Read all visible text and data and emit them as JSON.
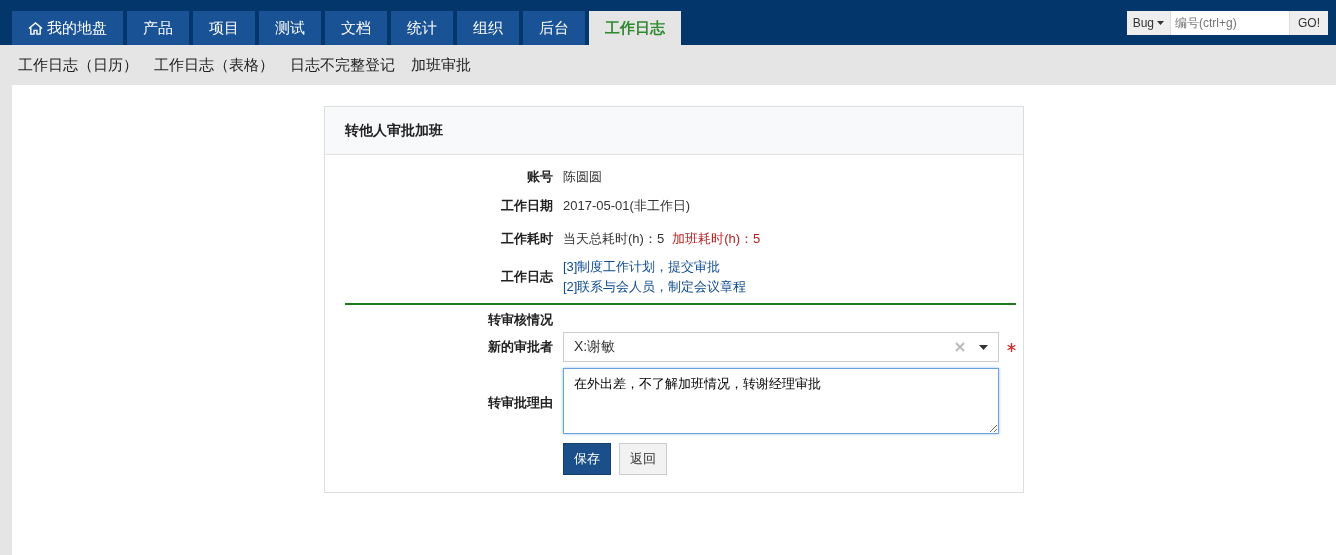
{
  "nav": {
    "tabs": [
      {
        "label": "我的地盘",
        "kind": "home",
        "selected": false
      },
      {
        "label": "产品",
        "selected": false
      },
      {
        "label": "项目",
        "selected": false
      },
      {
        "label": "测试",
        "selected": false
      },
      {
        "label": "文档",
        "selected": false
      },
      {
        "label": "统计",
        "selected": false
      },
      {
        "label": "组织",
        "selected": false
      },
      {
        "label": "后台",
        "selected": false
      },
      {
        "label": "工作日志",
        "selected": true
      }
    ],
    "search": {
      "type": "Bug",
      "placeholder": "编号(ctrl+g)",
      "button": "GO!"
    }
  },
  "subnav": [
    "工作日志（日历）",
    "工作日志（表格）",
    "日志不完整登记",
    "加班审批"
  ],
  "form": {
    "title": "转他人审批加班",
    "account": {
      "label": "账号",
      "value": "陈圆圆"
    },
    "date": {
      "label": "工作日期",
      "value": "2017-05-01(非工作日)"
    },
    "hours": {
      "label": "工作耗时",
      "total": "当天总耗时(h)：5",
      "overtime": "加班耗时(h)：5"
    },
    "logs": {
      "label": "工作日志",
      "items": [
        "[3]制度工作计划，提交审批",
        "[2]联系与会人员，制定会议章程"
      ]
    },
    "section": "转审核情况",
    "approver": {
      "label": "新的审批者",
      "value": "X:谢敏",
      "required": true
    },
    "reason": {
      "label": "转审批理由",
      "value": "在外出差，不了解加班情况，转谢经理审批"
    },
    "buttons": [
      "保存",
      "返回"
    ]
  }
}
